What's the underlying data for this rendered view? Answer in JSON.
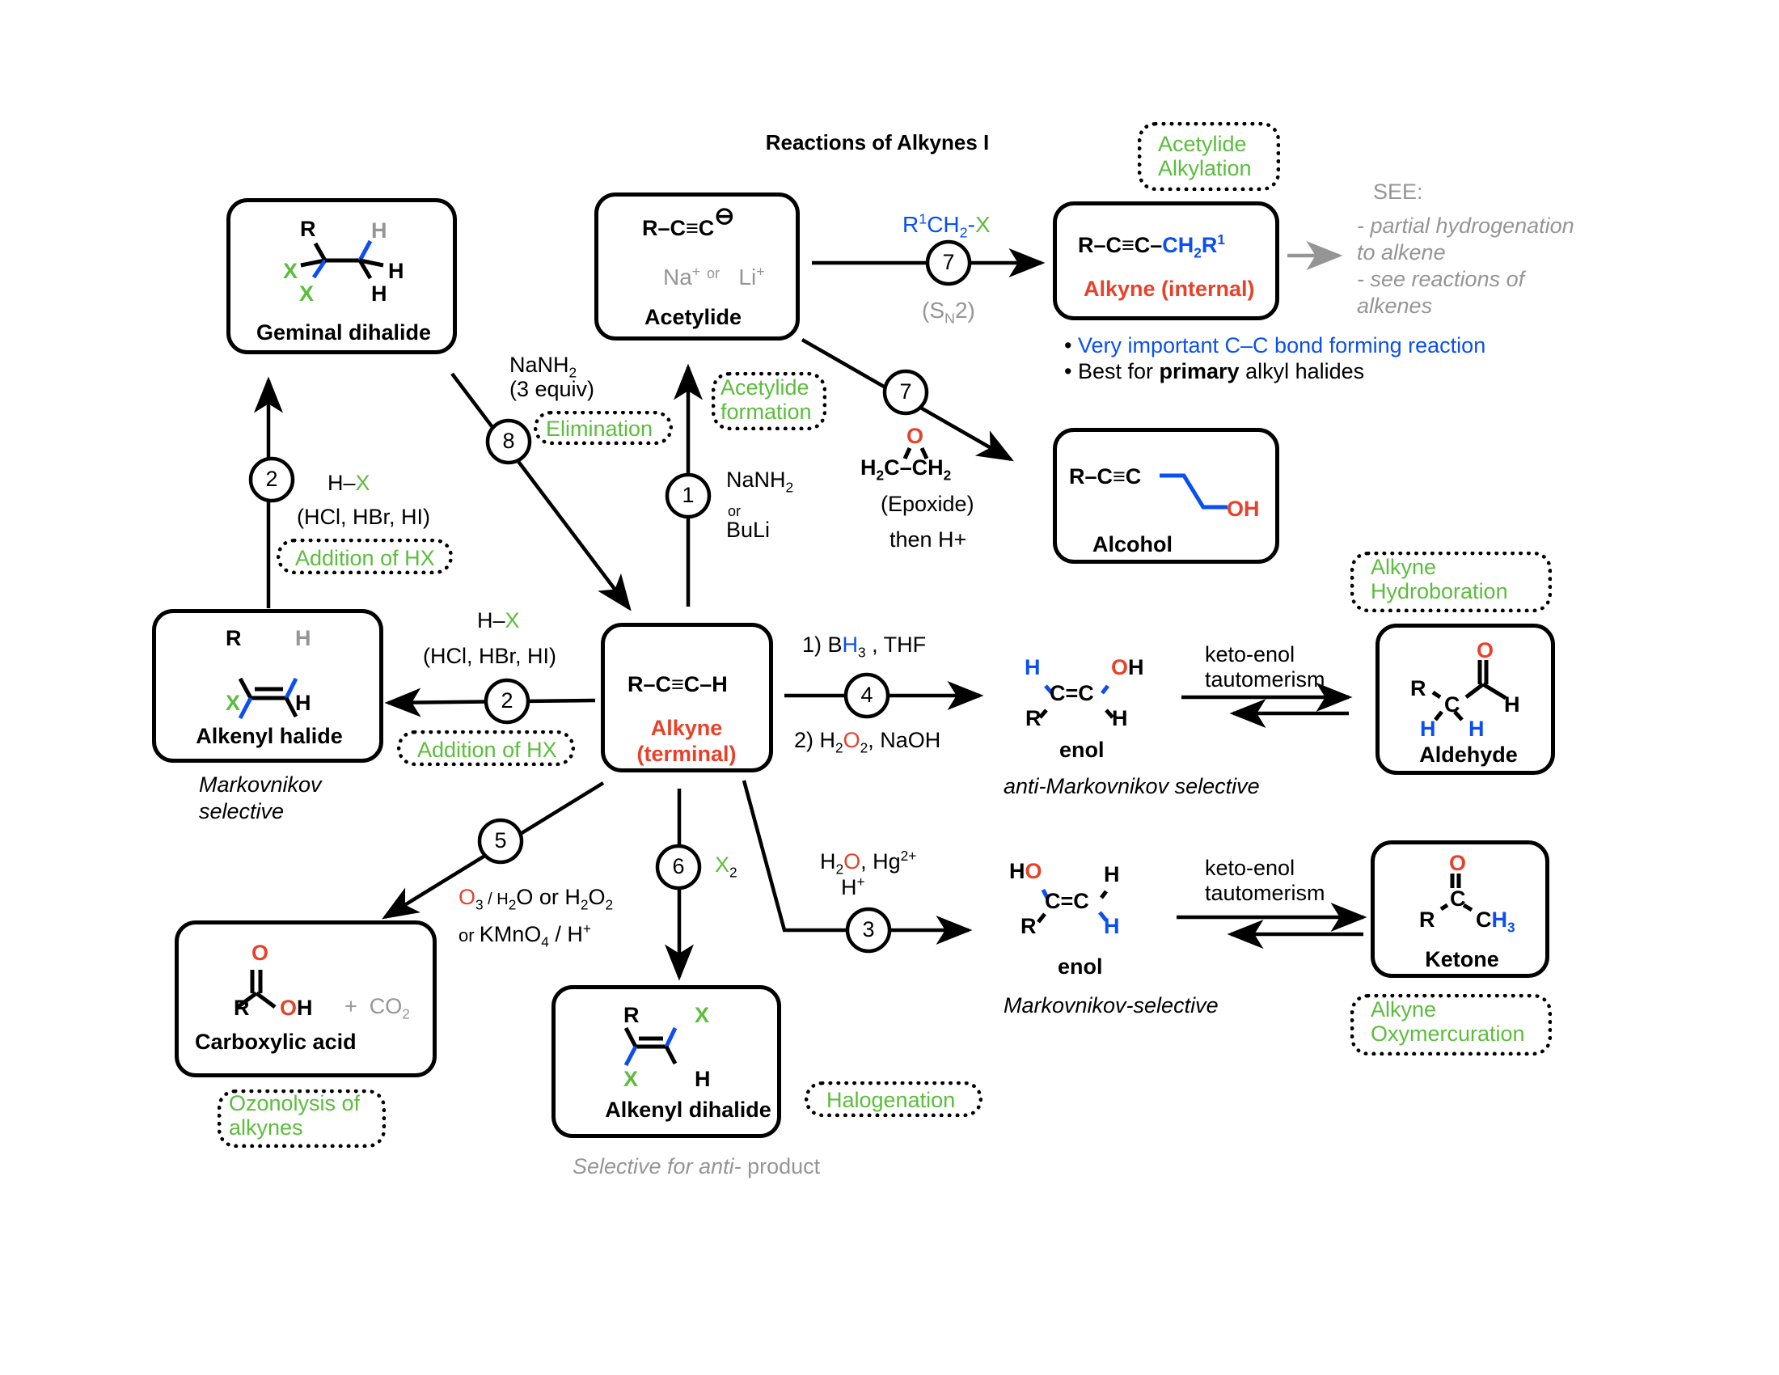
{
  "title": "Reactions of Alkynes I",
  "colors": {
    "green": "#5bbd3c",
    "blue": "#0b4ff0",
    "red": "#e8412a",
    "gray": "#959595",
    "black": "#000000"
  },
  "compounds": {
    "terminal_alkyne": {
      "formula": "R–C≡C–H",
      "name_line1": "Alkyne",
      "name_line2": "(terminal)"
    },
    "acetylide": {
      "formula": "R–C≡C",
      "charge": "⊖",
      "counterion_na": "Na",
      "counterion_or": "or",
      "counterion_li": "Li",
      "plus": "+",
      "name": "Acetylide"
    },
    "internal_alkyne": {
      "formula_left": "R–C≡C–",
      "formula_right": "CH",
      "sub2": "2",
      "r": "R",
      "sup1": "1",
      "name": "Alkyne (internal)"
    },
    "alcohol": {
      "formula": "R–C≡C",
      "oh": "OH",
      "name": "Alcohol"
    },
    "geminal_dihalide": {
      "r": "R",
      "x1": "X",
      "x2": "X",
      "h_gray": "H",
      "h1": "H",
      "h2": "H",
      "name": "Geminal dihalide"
    },
    "alkenyl_halide": {
      "r": "R",
      "x": "X",
      "h_gray": "H",
      "h": "H",
      "name": "Alkenyl halide"
    },
    "alkenyl_dihalide": {
      "r": "R",
      "x1": "X",
      "x2": "X",
      "h": "H",
      "name": "Alkenyl dihalide"
    },
    "carboxylic_acid": {
      "r": "R",
      "o": "O",
      "oh_o": "O",
      "oh_h": "H",
      "plus": "+",
      "co": "CO",
      "co_sub": "2",
      "name": "Carboxylic acid"
    },
    "aldehyde": {
      "r": "R",
      "c": "C",
      "o": "O",
      "h": "H",
      "h_blue1": "H",
      "h_blue2": "H",
      "name": "Aldehyde"
    },
    "ketone": {
      "r": "R",
      "c": "C",
      "o": "O",
      "ch": "C",
      "h3": "H",
      "sub3": "3",
      "name": "Ketone"
    },
    "enol_hydroboration": {
      "h_blue": "H",
      "o": "O",
      "oh_h": "H",
      "c1": "C",
      "c2": "C",
      "r": "R",
      "h": "H",
      "name": "enol"
    },
    "enol_oxymercuration": {
      "h": "H",
      "o": "O",
      "c1": "C",
      "c2": "C",
      "r": "R",
      "h_top": "H",
      "h_blue": "H",
      "name": "enol"
    }
  },
  "reactions": [
    {
      "number": "1",
      "reagent_line1": "NaNH",
      "reagent_sub": "2",
      "reagent_or": "or",
      "reagent_line2": "BuLi",
      "tag": [
        "Acetylide",
        "formation"
      ]
    },
    {
      "number": "2",
      "reagent_hx_h": "H–",
      "reagent_hx_x": "X",
      "reagent_list": "(HCl, HBr, HI)",
      "tag": [
        "Addition of HX"
      ]
    },
    {
      "number": "2",
      "reagent_hx_h": "H–",
      "reagent_hx_x": "X",
      "reagent_list": "(HCl, HBr, HI)",
      "tag": [
        "Addition of HX"
      ]
    },
    {
      "number": "3",
      "reagent_h2": "H",
      "reagent_h2_sub": "2",
      "reagent_o": "O",
      "reagent_rest": ", Hg",
      "reagent_sup": "2+",
      "reagent_h": "H",
      "reagent_hplus": "+",
      "tag": [
        "Alkyne",
        "Oxymercuration"
      ]
    },
    {
      "number": "4",
      "step1_pre": "1) B",
      "step1_h": "H",
      "step1_sub": "3",
      "step1_post": " , THF",
      "step2_pre": "2) H",
      "step2_sub1": "2",
      "step2_o": "O",
      "step2_sub2": "2",
      "step2_post": ", NaOH",
      "tag": [
        "Alkyne",
        "Hydroboration"
      ]
    },
    {
      "number": "5",
      "line1_o": "O",
      "line1_sub3": "3",
      "line1_rest_a": " / H",
      "line1_sub2a": "2",
      "line1_rest_b": "O or H",
      "line1_sub2b": "2",
      "line1_rest_c": "O",
      "line1_sub2c": "2",
      "line2_or": "or ",
      "line2_kmno": "KMnO",
      "line2_sub4": "4",
      "line2_rest": " / H",
      "line2_sup": "+",
      "tag": [
        "Ozonolysis of",
        "alkynes"
      ]
    },
    {
      "number": "6",
      "reagent_x": "X",
      "reagent_sub": "2",
      "tag": [
        "Halogenation"
      ]
    },
    {
      "number": "7",
      "reagent_r": "R",
      "reagent_sup": "1",
      "reagent_ch": "CH",
      "reagent_sub": "2",
      "reagent_dash": "-",
      "reagent_x": "X",
      "mechanism_pre": "(S",
      "mechanism_sub": "N",
      "mechanism_post": "2)",
      "tag": [
        "Acetylide",
        "Alkylation"
      ]
    },
    {
      "number": "7",
      "epoxide_o": "O",
      "epoxide_left": "H",
      "epoxide_left_sub": "2",
      "epoxide_c": "C",
      "epoxide_right": "CH",
      "epoxide_right_sub": "2",
      "label": "(Epoxide)",
      "then": "then H+"
    },
    {
      "number": "8",
      "reagent_line1": "NaNH",
      "reagent_sub": "2",
      "reagent_line2": "(3 equiv)",
      "tag": [
        "Elimination"
      ]
    }
  ],
  "notes": {
    "see_title": "SEE:",
    "see_items": [
      "- partial hydrogenation",
      "to alkene",
      "- see reactions of",
      "alkenes"
    ],
    "bullet1": "Very important C–C bond forming reaction",
    "bullet2_pre": "Best for ",
    "bullet2_bold": "primary",
    "bullet2_post": " alkyl halides",
    "markovnikov_line1": "Markovnikov",
    "markovnikov_line2": "selective",
    "anti_markovnikov": "anti-Markovnikov selective",
    "markovnikov_selective": "Markovnikov-selective",
    "anti_product_pre": "Selective for anti-",
    "anti_product_post": " product",
    "keto_enol_line1": "keto-enol",
    "keto_enol_line2": "tautomerism"
  }
}
